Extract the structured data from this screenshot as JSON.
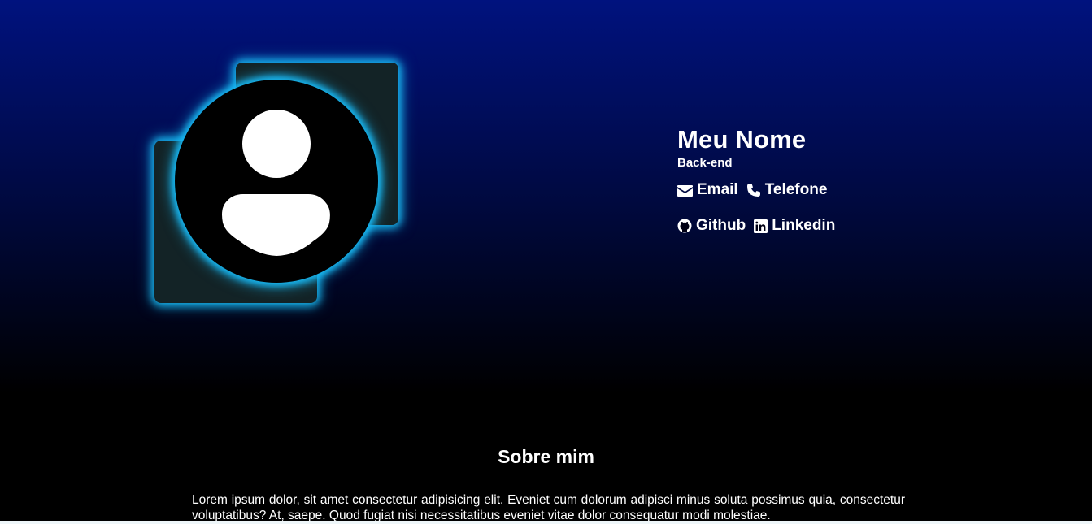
{
  "profile": {
    "name": "Meu Nome",
    "role": "Back-end",
    "avatar_icon": "user-icon"
  },
  "contacts": [
    {
      "label": "Email",
      "icon": "envelope-icon"
    },
    {
      "label": "Telefone",
      "icon": "phone-icon"
    }
  ],
  "socials": [
    {
      "label": "Github",
      "icon": "github-icon"
    },
    {
      "label": "Linkedin",
      "icon": "linkedin-icon"
    }
  ],
  "about": {
    "title": "Sobre mim",
    "text": "Lorem ipsum dolor, sit amet consectetur adipisicing elit. Eveniet cum dolorum adipisci minus soluta possimus quia, consectetur voluptatibus? At, saepe. Quod fugiat nisi necessitatibus eveniet vitae dolor consequatur modi molestiae."
  },
  "colors": {
    "gradient_top": "#00127e",
    "gradient_bottom": "#000000",
    "glow": "#18b6f0",
    "square_fill": "#132326",
    "text": "#ffffff"
  }
}
